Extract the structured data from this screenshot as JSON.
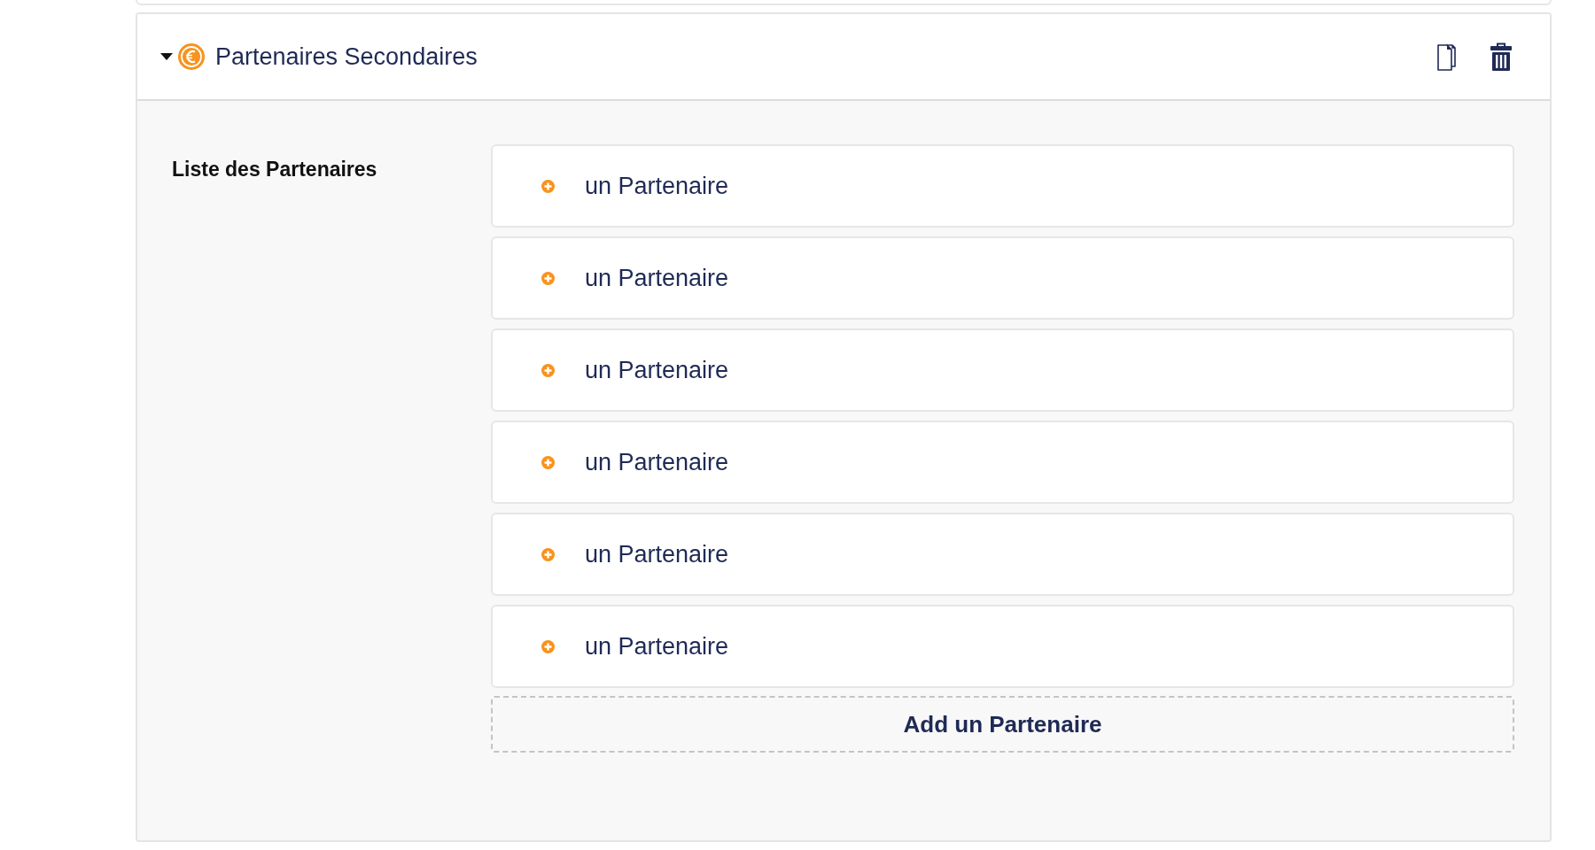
{
  "panel": {
    "title": "Partenaires Secondaires",
    "expanded": true,
    "actions": [
      {
        "kind": "copy"
      },
      {
        "kind": "delete"
      }
    ]
  },
  "field": {
    "label": "Liste des Partenaires"
  },
  "items": [
    {
      "label": "un Partenaire"
    },
    {
      "label": "un Partenaire"
    },
    {
      "label": "un Partenaire"
    },
    {
      "label": "un Partenaire"
    },
    {
      "label": "un Partenaire"
    },
    {
      "label": "un Partenaire"
    }
  ],
  "add_button": {
    "label": "Add un Partenaire"
  }
}
